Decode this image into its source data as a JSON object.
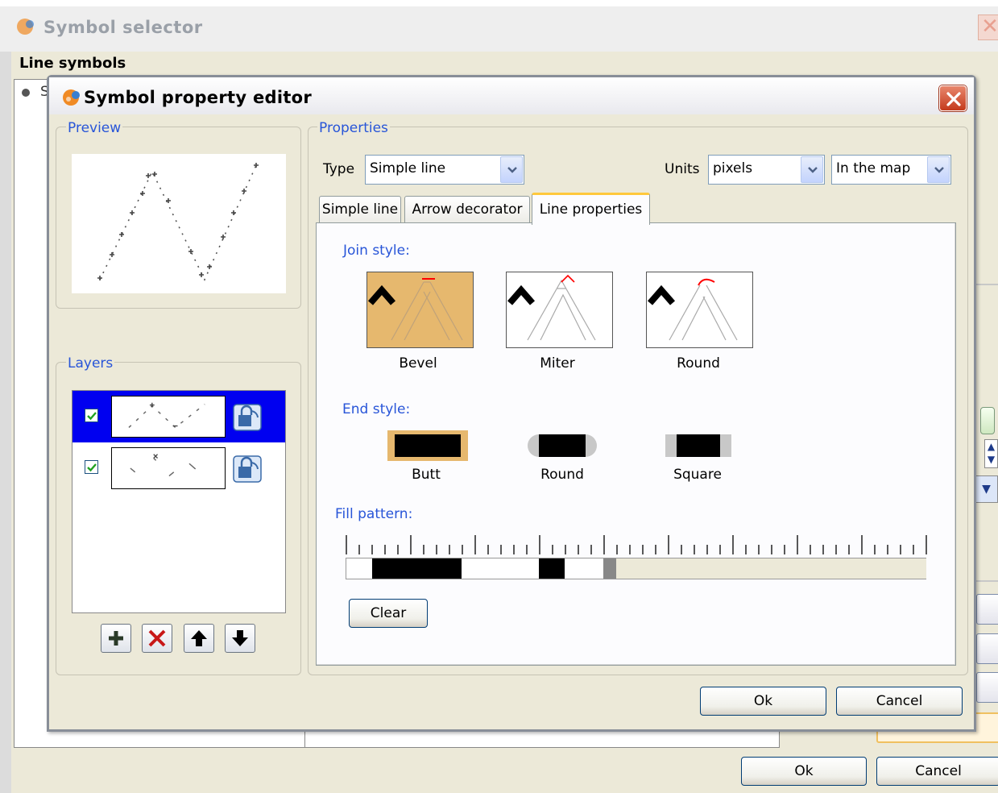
{
  "background_dialog": {
    "title": "Symbol selector",
    "section_label": "Line symbols",
    "list_fragment": "S",
    "ok_label": "Ok",
    "cancel_label": "Cancel"
  },
  "dialog": {
    "title": "Symbol property editor",
    "close_icon": "close-icon",
    "preview_legend": "Preview",
    "layers_legend": "Layers",
    "properties_legend": "Properties",
    "type_label": "Type",
    "type_value": "Simple line",
    "units_label": "Units",
    "units_value": "pixels",
    "units_scope_value": "In the map",
    "tabs": [
      {
        "label": "Simple line",
        "active": false
      },
      {
        "label": "Arrow decorator",
        "active": false
      },
      {
        "label": "Line properties",
        "active": true
      }
    ],
    "join_style_label": "Join style:",
    "join_styles": [
      {
        "label": "Bevel",
        "selected": true
      },
      {
        "label": "Miter",
        "selected": false
      },
      {
        "label": "Round",
        "selected": false
      }
    ],
    "end_style_label": "End style:",
    "end_styles": [
      {
        "label": "Butt",
        "selected": true
      },
      {
        "label": "Round",
        "selected": false
      },
      {
        "label": "Square",
        "selected": false
      }
    ],
    "fill_pattern_label": "Fill pattern:",
    "clear_label": "Clear",
    "ok_label": "Ok",
    "cancel_label": "Cancel",
    "layers": [
      {
        "checked": true,
        "selected": true,
        "icon": "lock-icon"
      },
      {
        "checked": true,
        "selected": false,
        "icon": "lock-icon"
      }
    ],
    "layer_toolbar": [
      "add-layer-icon",
      "remove-layer-icon",
      "move-up-icon",
      "move-down-icon"
    ]
  },
  "colors": {
    "selection_highlight": "#e6b86e",
    "legend_text": "#2855d8",
    "layer_selected_bg": "#0000f0",
    "dialog_bg": "#ece9d8"
  }
}
